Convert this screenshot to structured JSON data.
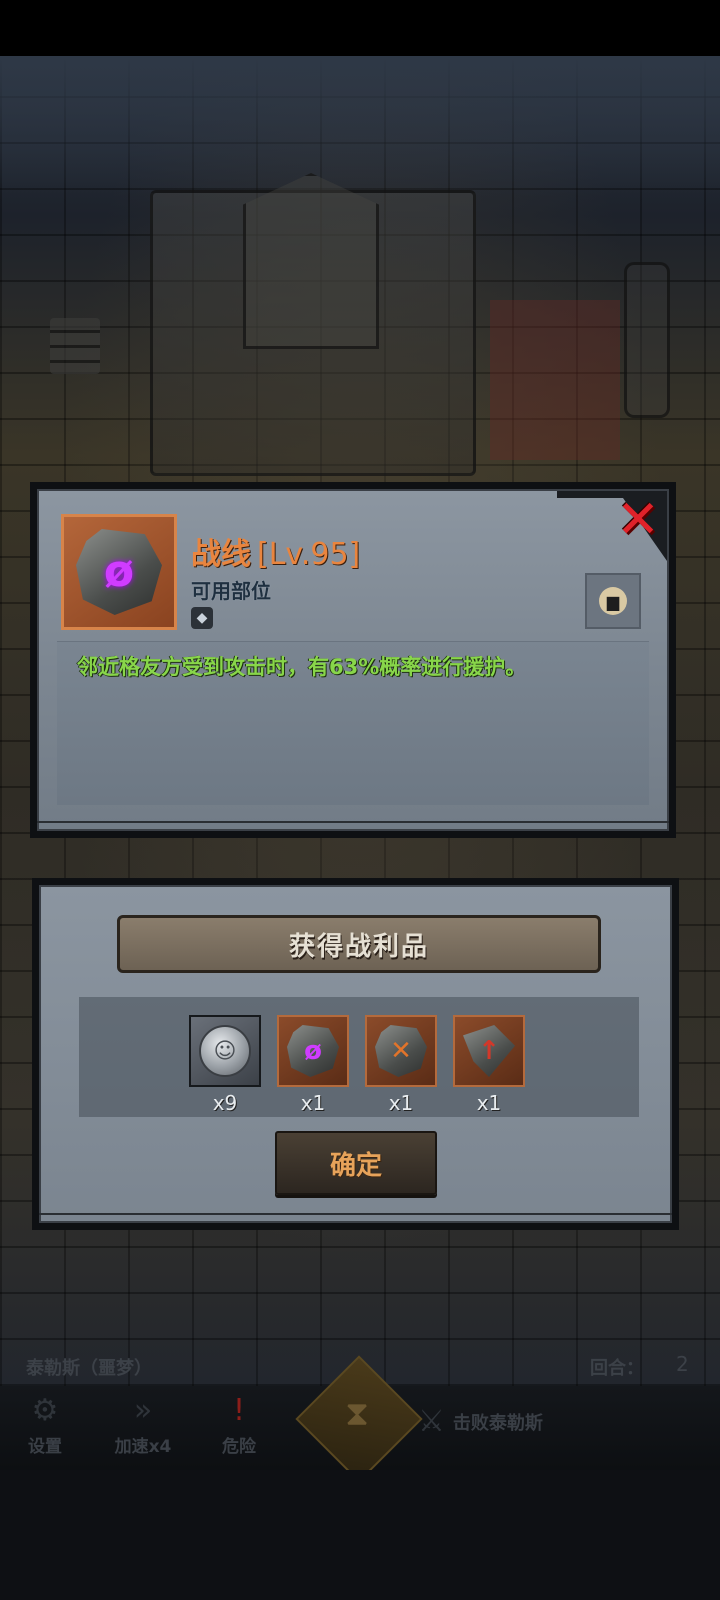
{
  "item_detail": {
    "name": "战线",
    "level": "[Lv.95]",
    "usable_slot_label": "可用部位",
    "description": "邻近格友方受到攻击时，有63%概率进行援护。",
    "icon": "purple-rune-stone-icon",
    "slot_icon": "armor-slot-icon",
    "lock_icon": "lock-icon",
    "close_icon": "close-x-icon"
  },
  "loot": {
    "title": "获得战利品",
    "items": [
      {
        "icon": "silver-coin-icon",
        "count": "x9",
        "rarity": "gray"
      },
      {
        "icon": "purple-rune-stone-icon",
        "count": "x1",
        "rarity": "orange"
      },
      {
        "icon": "orange-rune-stone-icon",
        "count": "x1",
        "rarity": "orange"
      },
      {
        "icon": "red-arrow-stone-icon",
        "count": "x1",
        "rarity": "orange"
      }
    ],
    "confirm_label": "确定"
  },
  "hud": {
    "boss_name": "泰勒斯（噩梦）",
    "round_label": "回合：",
    "round_value": "2",
    "buttons": [
      {
        "label": "设置",
        "icon": "gear-icon"
      },
      {
        "label": "加速x4",
        "icon": "fast-forward-icon"
      },
      {
        "label": "危险",
        "icon": "danger-icon"
      }
    ],
    "hourglass_icon": "hourglass-icon",
    "objective_text": "击败泰勒斯",
    "objective_icon": "crossed-swords-icon"
  },
  "colors": {
    "title_orange": "#e9853f",
    "desc_green": "#88d64a",
    "close_red": "#e0222a"
  }
}
